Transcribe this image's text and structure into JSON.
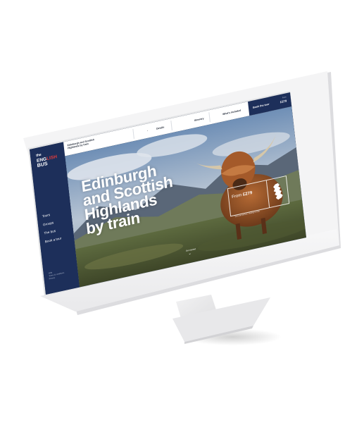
{
  "sidebar": {
    "logo": {
      "line1": "the",
      "line2_main": "ENG",
      "line2_accent": "LISH",
      "line3": "BUS"
    },
    "nav": [
      "Tours",
      "Groups",
      "The bus",
      "Book a tour"
    ],
    "footer": [
      "Help",
      "Terms & conditions",
      "Privacy"
    ]
  },
  "topbar": {
    "title": "Edinburgh and Scottish Highlands by train",
    "dot": "•",
    "links": [
      "Details",
      "Itinerary",
      "What's included"
    ]
  },
  "book": {
    "label": "Book the tour",
    "price_label": "From",
    "price": "£279"
  },
  "hero": {
    "headline": [
      "Edinburgh",
      "and Scottish",
      "Highlands",
      "by train"
    ],
    "price_prefix": "From",
    "price_value": "£279",
    "price_note": "*price per person, sharing a room",
    "scroll_label": "Get started"
  },
  "colors": {
    "navy": "#1d2f5a",
    "accent_red": "#e23b3b",
    "device_white": "#f4f4f5"
  },
  "icons": [
    "scotland-map-icon",
    "chevron-down-icon"
  ]
}
